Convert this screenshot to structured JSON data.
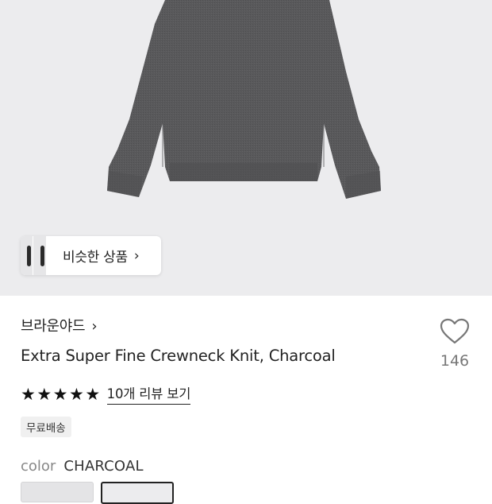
{
  "similar_products": {
    "label": "비슷한 상품",
    "chevron": "chevron-right-icon"
  },
  "product": {
    "brand": "브라운야드",
    "title": "Extra Super Fine Crewneck Knit, Charcoal",
    "wishlist_count": "146",
    "rating_stars": 5,
    "review_link": "10개 리뷰 보기",
    "shipping_badge": "무료배송",
    "color_label": "color",
    "color_value": "CHARCOAL"
  },
  "colors": {
    "sweater": "#58585a",
    "hero_bg": "#ececee"
  }
}
